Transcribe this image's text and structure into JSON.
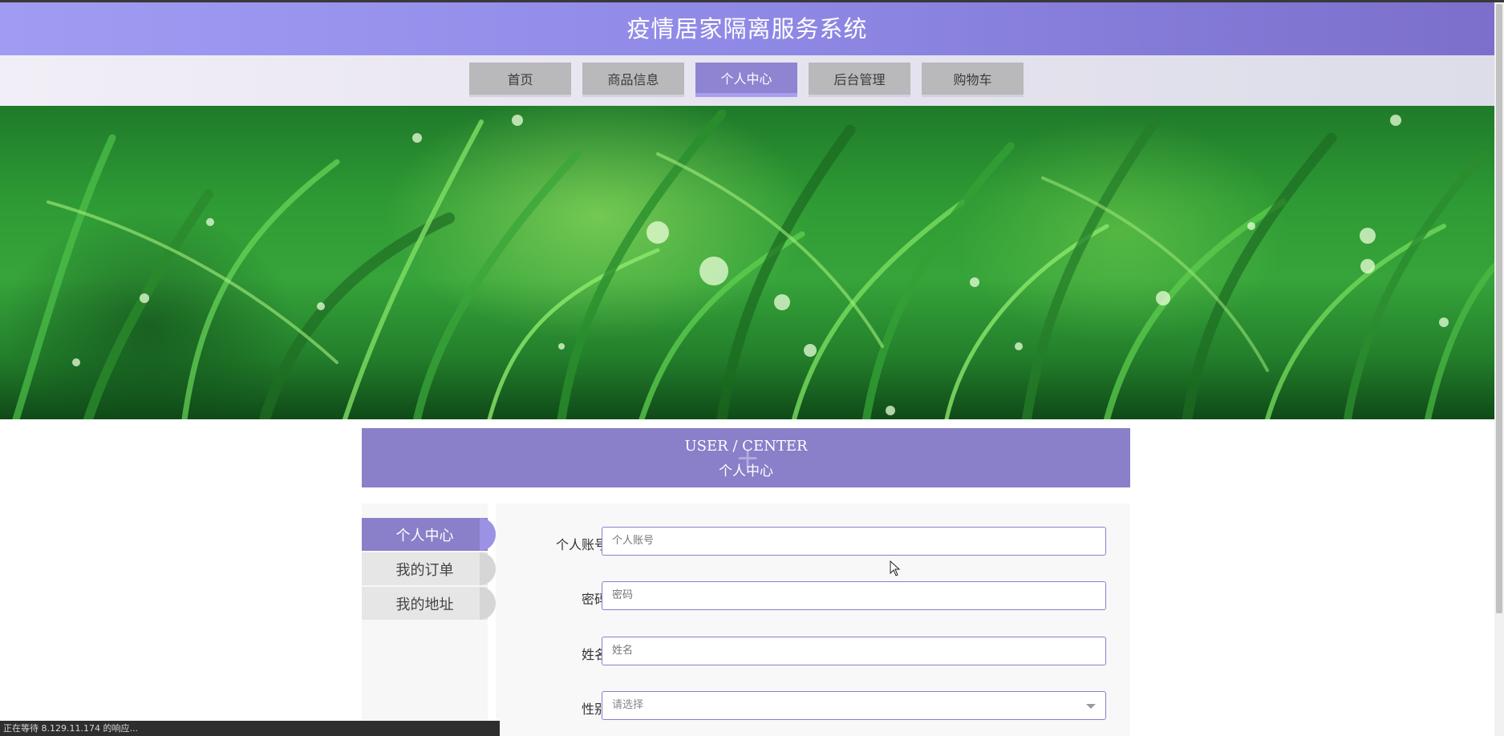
{
  "app": {
    "title": "疫情居家隔离服务系统"
  },
  "nav": {
    "items": [
      {
        "label": "首页"
      },
      {
        "label": "商品信息"
      },
      {
        "label": "个人中心"
      },
      {
        "label": "后台管理"
      },
      {
        "label": "购物车"
      }
    ],
    "active": "个人中心"
  },
  "banner": {
    "icon": "grass-photo"
  },
  "section": {
    "title_en": "USER / CENTER",
    "title_cn": "个人中心"
  },
  "sidebar": {
    "items": [
      {
        "label": "个人中心"
      },
      {
        "label": "我的订单"
      },
      {
        "label": "我的地址"
      }
    ],
    "active": "个人中心"
  },
  "form": {
    "account": {
      "label": "个人账号",
      "placeholder": "个人账号"
    },
    "password": {
      "label": "密码",
      "placeholder": "密码"
    },
    "name": {
      "label": "姓名",
      "placeholder": "姓名"
    },
    "gender": {
      "label": "性别",
      "placeholder": "请选择"
    }
  },
  "status_bar": {
    "text": "正在等待 8.129.11.174 的响应..."
  },
  "colors": {
    "accent": "#8a7fc9",
    "header_start": "#a09cf3",
    "header_end": "#7b6fcb"
  }
}
